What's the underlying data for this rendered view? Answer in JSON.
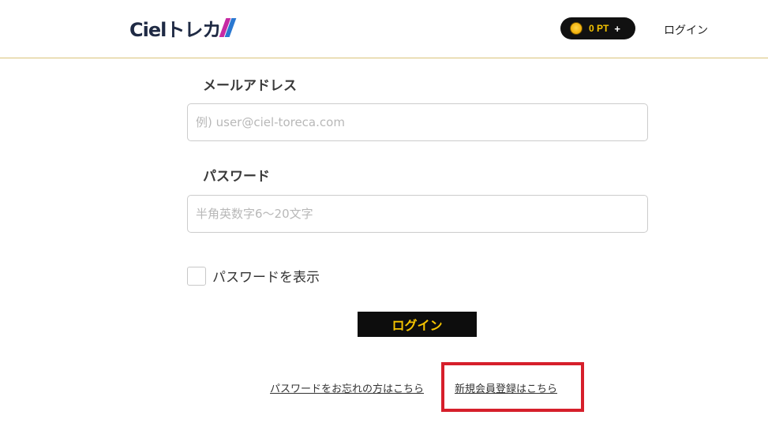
{
  "header": {
    "logo_text": "Cielトレカ",
    "points": "0 PT",
    "points_plus": "+",
    "login_label": "ログイン"
  },
  "form": {
    "email_label": "メールアドレス",
    "email_placeholder": "例) user@ciel-toreca.com",
    "email_value": "",
    "password_label": "パスワード",
    "password_placeholder": "半角英数字6〜20文字",
    "password_value": "",
    "show_password_label": "パスワードを表示",
    "show_password_checked": false,
    "submit_label": "ログイン"
  },
  "links": {
    "forgot": "パスワードをお忘れの方はこちら",
    "register": "新規会員登録はこちら"
  },
  "colors": {
    "accent": "#f5c400",
    "button_bg": "#0d0d0d",
    "highlight": "#d61f2b",
    "header_border": "#d9c37a"
  },
  "icons": {
    "coin": "coin-icon",
    "logo_mark": "logo-slash-icon"
  }
}
